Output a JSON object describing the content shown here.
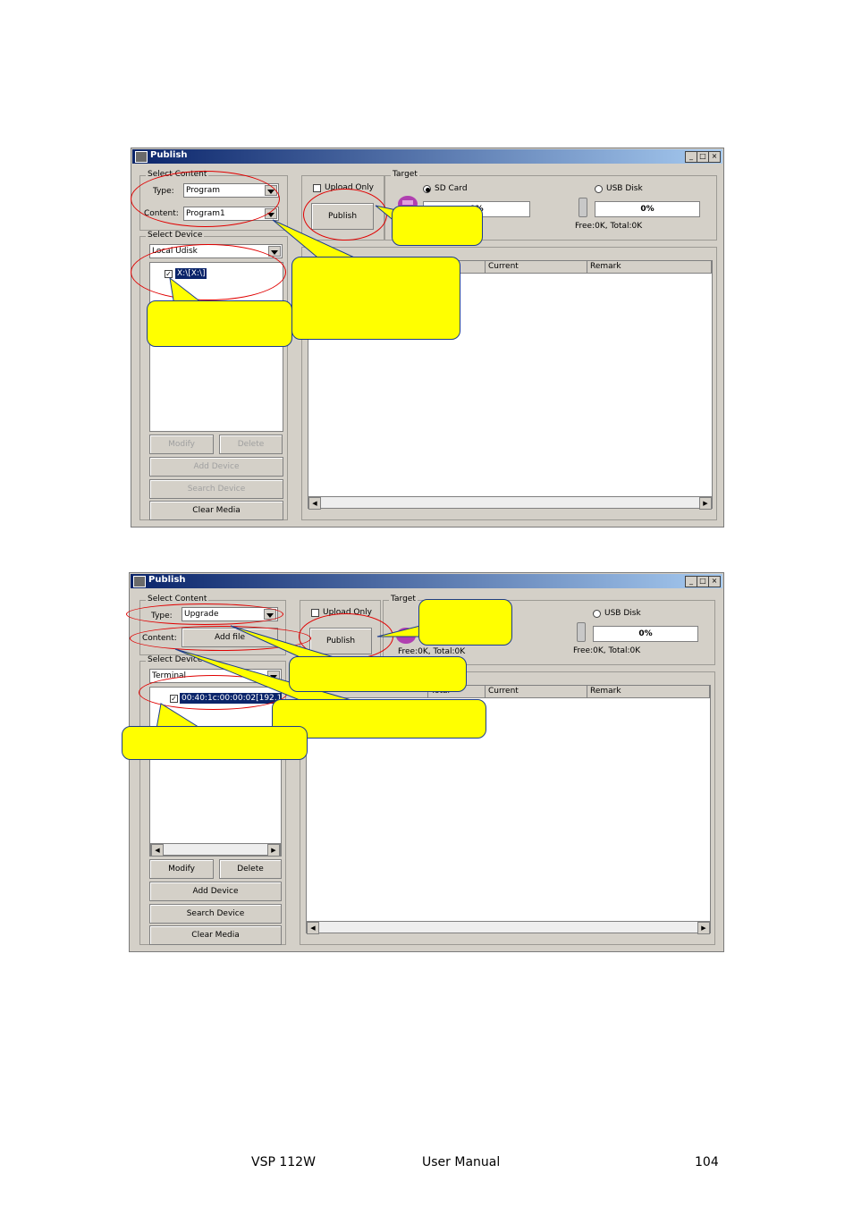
{
  "window_title": "Publish",
  "title_buttons": [
    "_",
    "□",
    "×"
  ],
  "group_labels": {
    "select_content": "Select Content",
    "select_device": "Select Device",
    "target": "Target"
  },
  "labels": {
    "type": "Type:",
    "content": "Content:",
    "upload_only": "Upload Only",
    "sd_card": "SD Card",
    "usb_disk": "USB Disk",
    "free_total": "Free:0K, Total:0K"
  },
  "buttons": {
    "publish": "Publish",
    "modify": "Modify",
    "delete": "Delete",
    "add_device": "Add Device",
    "search_device": "Search Device",
    "clear_media": "Clear Media",
    "add_file": "Add file"
  },
  "columns": [
    "Current",
    "Remark"
  ],
  "columns2": [
    "Total",
    "Current",
    "Remark"
  ],
  "screenshot1": {
    "type_value": "Program",
    "content_value": "Program1",
    "device_combo": "Local Udisk",
    "device_item": "X:\\[X:\\]",
    "sd_progress": "0%",
    "usb_progress": "0%",
    "partial_p": "P"
  },
  "screenshot2": {
    "type_value": "Upgrade",
    "device_combo": "Terminal",
    "device_item": "00:40:1c:00:00:02[192.168",
    "usb_progress": "0%"
  },
  "footer": {
    "model": "VSP 112W",
    "manual": "User Manual",
    "page": "104"
  }
}
